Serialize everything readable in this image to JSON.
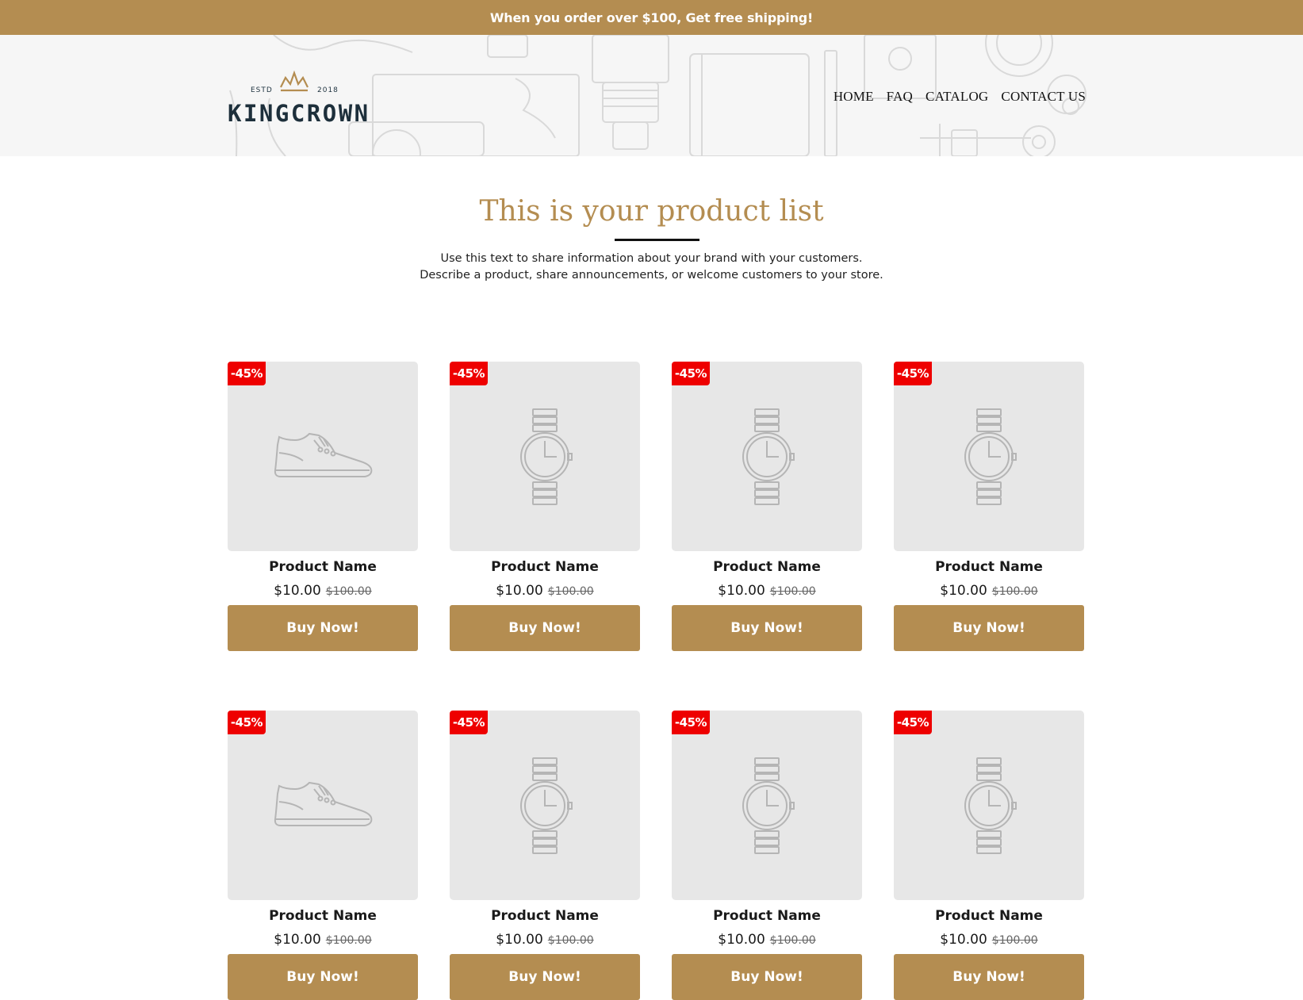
{
  "announcement": "When you order over $100, Get free shipping!",
  "brand": {
    "estd": "ESTD",
    "year": "2018",
    "name": "KINGCROWN",
    "logo_icon": "crown-icon"
  },
  "nav": [
    "HOME",
    "FAQ",
    "CATALOG",
    "CONTACT US"
  ],
  "section": {
    "title": "This is your product list",
    "text_line1": "Use this text to share information about your brand with your customers.",
    "text_line2": "Describe a product, share announcements, or welcome customers to your store."
  },
  "products": [
    {
      "name": "Product Name",
      "price": "$10.00",
      "compare_price": "$100.00",
      "badge": "-45%",
      "button": "Buy Now!",
      "icon": "sneaker-icon"
    },
    {
      "name": "Product Name",
      "price": "$10.00",
      "compare_price": "$100.00",
      "badge": "-45%",
      "button": "Buy Now!",
      "icon": "watch-icon"
    },
    {
      "name": "Product Name",
      "price": "$10.00",
      "compare_price": "$100.00",
      "badge": "-45%",
      "button": "Buy Now!",
      "icon": "watch-icon"
    },
    {
      "name": "Product Name",
      "price": "$10.00",
      "compare_price": "$100.00",
      "badge": "-45%",
      "button": "Buy Now!",
      "icon": "watch-icon"
    },
    {
      "name": "Product Name",
      "price": "$10.00",
      "compare_price": "$100.00",
      "badge": "-45%",
      "button": "Buy Now!",
      "icon": "sneaker-icon"
    },
    {
      "name": "Product Name",
      "price": "$10.00",
      "compare_price": "$100.00",
      "badge": "-45%",
      "button": "Buy Now!",
      "icon": "watch-icon"
    },
    {
      "name": "Product Name",
      "price": "$10.00",
      "compare_price": "$100.00",
      "badge": "-45%",
      "button": "Buy Now!",
      "icon": "watch-icon"
    },
    {
      "name": "Product Name",
      "price": "$10.00",
      "compare_price": "$100.00",
      "badge": "-45%",
      "button": "Buy Now!",
      "icon": "watch-icon"
    }
  ],
  "colors": {
    "accent": "#b48d51",
    "badge": "#ee0000",
    "card_bg": "#e7e7e7",
    "hero_bg": "#f6f6f6"
  }
}
